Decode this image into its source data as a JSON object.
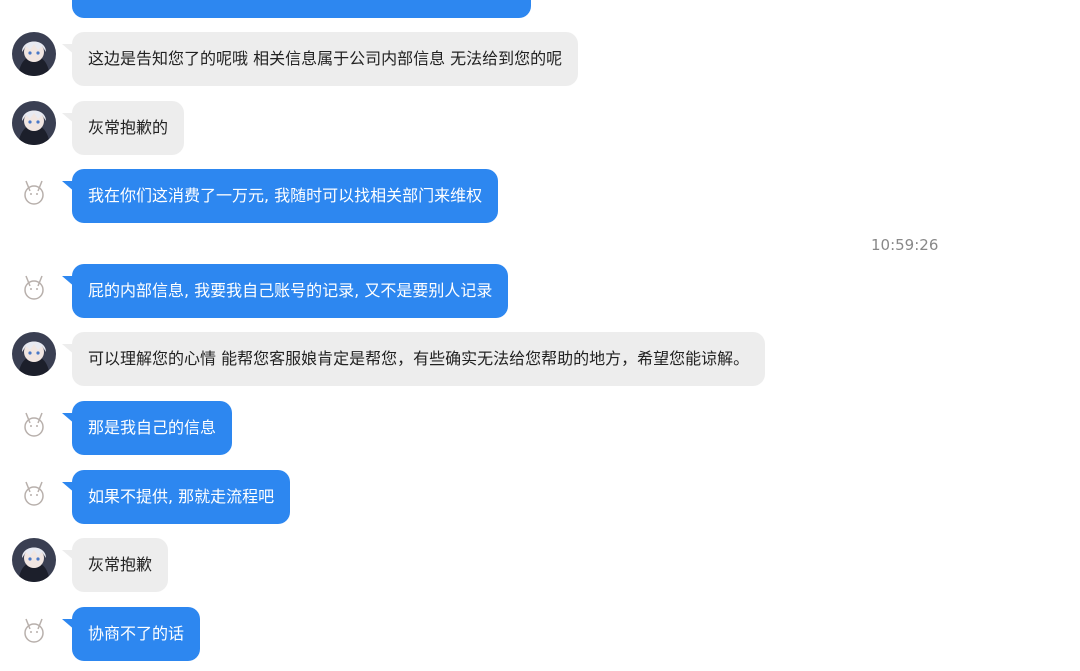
{
  "colors": {
    "user_bubble": "#2d87f0",
    "agent_bubble": "#ededed",
    "agent_text": "#222222",
    "user_text": "#ffffff",
    "timestamp": "#888888"
  },
  "timestamp": "10:59:26",
  "messages": [
    {
      "sender": "agent",
      "text": "这边是告知您了的呢哦 相关信息属于公司内部信息 无法给到您的呢"
    },
    {
      "sender": "agent",
      "text": "灰常抱歉的"
    },
    {
      "sender": "user",
      "text": "我在你们这消费了一万元, 我随时可以找相关部门来维权"
    },
    {
      "sender": "user",
      "text": "屁的内部信息, 我要我自己账号的记录, 又不是要别人记录"
    },
    {
      "sender": "agent",
      "text": "可以理解您的心情 能帮您客服娘肯定是帮您，有些确实无法给您帮助的地方，希望您能谅解。"
    },
    {
      "sender": "user",
      "text": "那是我自己的信息"
    },
    {
      "sender": "user",
      "text": "如果不提供, 那就走流程吧"
    },
    {
      "sender": "agent",
      "text": "灰常抱歉"
    },
    {
      "sender": "user",
      "text": "协商不了的话"
    }
  ]
}
